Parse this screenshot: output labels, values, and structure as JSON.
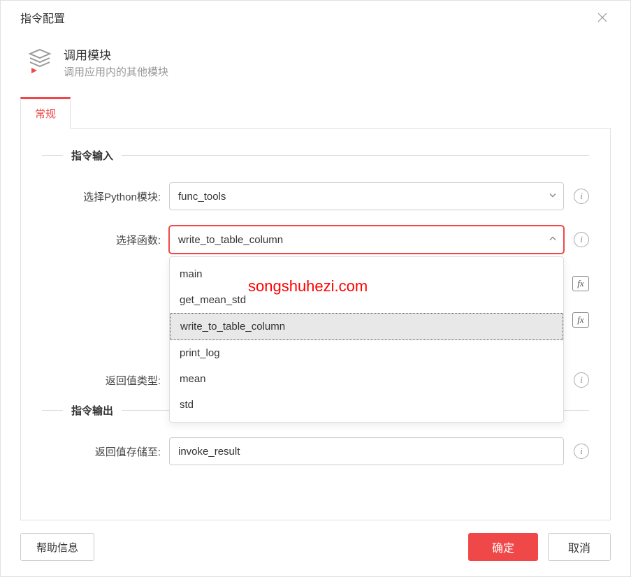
{
  "dialog_title": "指令配置",
  "module": {
    "title": "调用模块",
    "description": "调用应用内的其他模块"
  },
  "tabs": {
    "general": "常规"
  },
  "sections": {
    "input": "指令输入",
    "output": "指令输出"
  },
  "form": {
    "python_module_label": "选择Python模块:",
    "python_module_value": "func_tools",
    "function_label": "选择函数:",
    "function_value": "write_to_table_column",
    "function_options": [
      "main",
      "get_mean_std",
      "write_to_table_column",
      "print_log",
      "mean",
      "std"
    ],
    "return_type_label": "返回值类型:",
    "return_store_label": "返回值存储至:",
    "return_store_value": "invoke_result"
  },
  "buttons": {
    "help": "帮助信息",
    "ok": "确定",
    "cancel": "取消"
  },
  "watermark": "songshuhezi.com"
}
